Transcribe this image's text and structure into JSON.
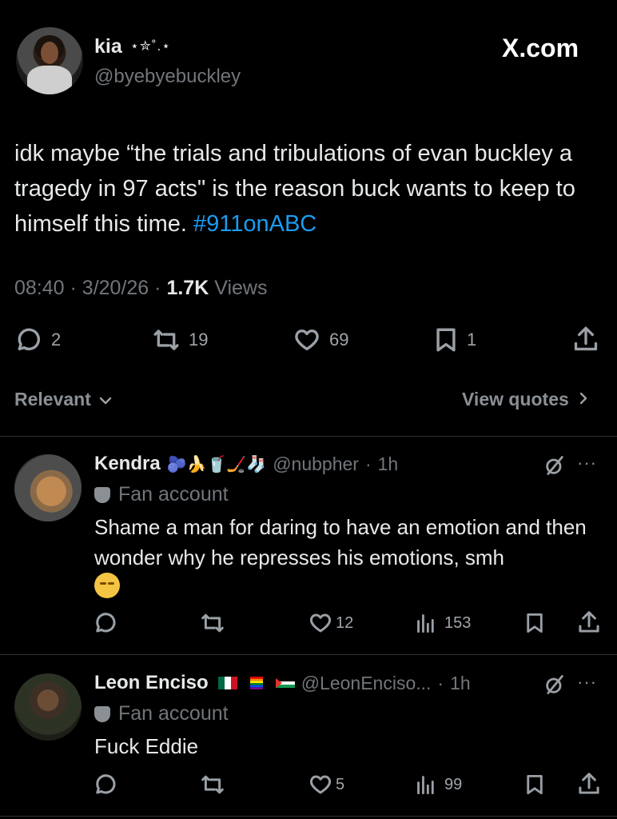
{
  "brand": {
    "watermark": "X.com"
  },
  "tweet": {
    "author_name": "kia",
    "author_name_deco": "⋆✮˚.⋆",
    "author_handle": "@byebyebuckley",
    "text_main": "idk maybe “the trials and tribulations of evan buckley a tragedy in 97 acts\" is the reason buck wants to keep to himself this time. ",
    "hashtag": "#911onABC",
    "time": "08:40",
    "date": "3/20/26",
    "views_count": "1.7K",
    "views_label": "Views",
    "replies": "2",
    "reposts": "19",
    "likes": "69",
    "bookmarks": "1"
  },
  "filters": {
    "sort_label": "Relevant",
    "view_quotes": "View quotes"
  },
  "replies": [
    {
      "name": "Kendra",
      "name_emojis": "🫐🍌🥤🏒🧦",
      "handle": "@nubpher",
      "time": "1h",
      "badge": "Fan account",
      "text": "Shame a man for daring to have an emotion and then wonder why he represses his emotions, smh",
      "likes": "12",
      "views": "153"
    },
    {
      "name": "Leon Enciso",
      "handle": "@LeonEnciso...",
      "time": "1h",
      "badge": "Fan account",
      "text": "Fuck Eddie",
      "likes": "5",
      "views": "99"
    }
  ],
  "colors": {
    "accent": "#1d9bf0",
    "muted": "#71767b",
    "background": "#000000"
  }
}
